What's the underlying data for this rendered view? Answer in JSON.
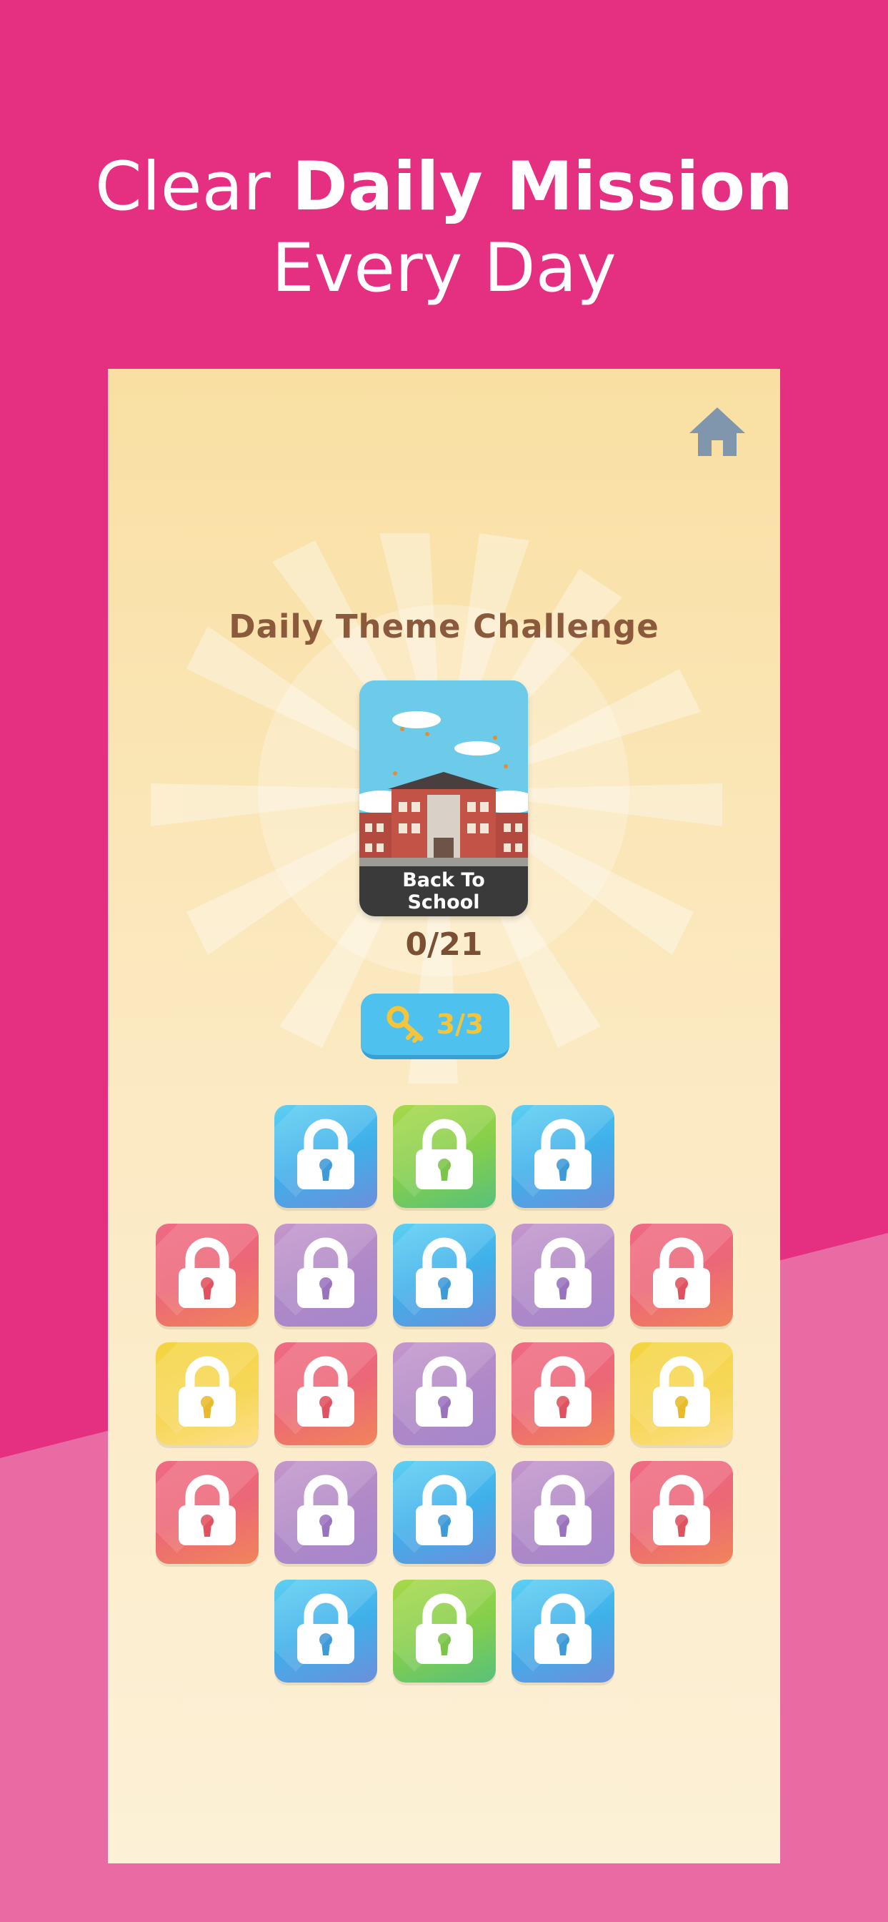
{
  "headline": {
    "line1_normal": "Clear ",
    "line1_bold": "Daily Mission",
    "line2": "Every Day"
  },
  "game": {
    "home_icon": "home-icon",
    "title": "Daily Theme Challenge",
    "theme": {
      "name_line1": "Back To",
      "name_line2": "School"
    },
    "progress": "0/21",
    "keys": {
      "icon": "key-icon",
      "count": "3/3"
    },
    "level_tiles": [
      [
        "blue",
        "green",
        "blue"
      ],
      [
        "red",
        "purple",
        "blue",
        "purple",
        "red"
      ],
      [
        "yellow",
        "red",
        "purple",
        "red",
        "yellow"
      ],
      [
        "red",
        "purple",
        "blue",
        "purple",
        "red"
      ],
      [
        "blue",
        "green",
        "blue"
      ]
    ],
    "lock_icon": "lock-icon",
    "colors": {
      "background": "#e52f80",
      "background_lower": "#e86ba4",
      "title": "#8b5a3c",
      "key_button": "#4fc1ee",
      "key_count": "#f4c53a"
    }
  }
}
